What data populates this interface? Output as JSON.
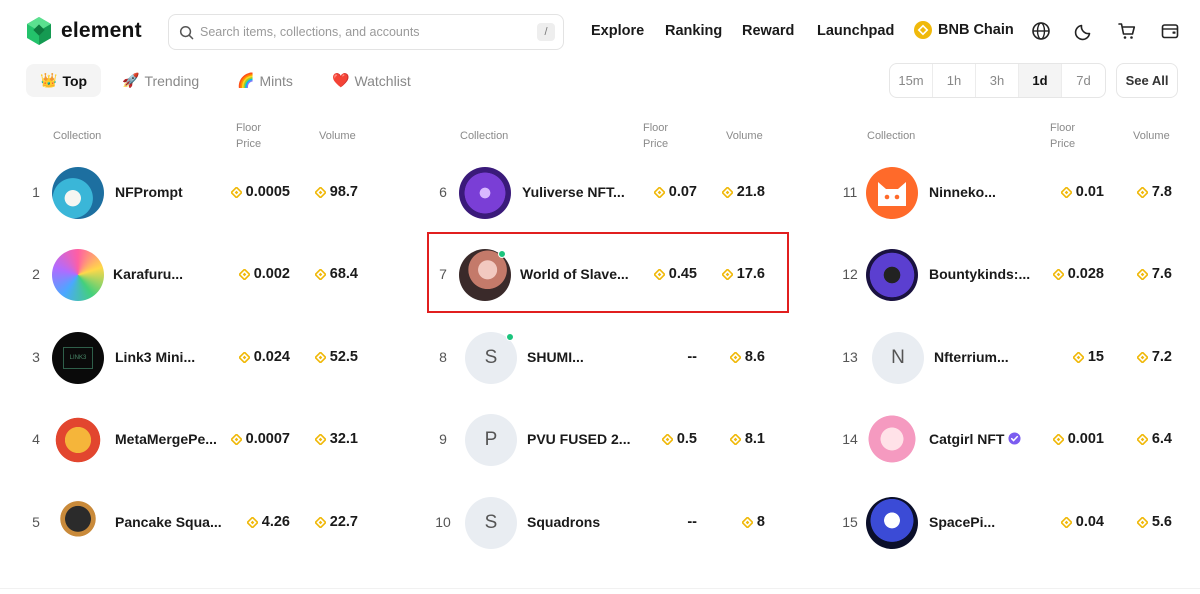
{
  "header": {
    "logo_text": "element",
    "search_placeholder": "Search items, collections, and accounts",
    "search_shortcut": "/",
    "nav": [
      "Explore",
      "Ranking",
      "Reward",
      "Launchpad"
    ],
    "chain_label": "BNB Chain",
    "icons": [
      "globe-icon",
      "moon-icon",
      "cart-icon",
      "wallet-icon"
    ]
  },
  "tabs": [
    {
      "icon": "👑",
      "label": "Top",
      "active": true
    },
    {
      "icon": "🚀",
      "label": "Trending",
      "active": false
    },
    {
      "icon": "🌈",
      "label": "Mints",
      "active": false
    },
    {
      "icon": "❤️",
      "label": "Watchlist",
      "active": false
    }
  ],
  "time_filters": [
    "15m",
    "1h",
    "3h",
    "1d",
    "7d"
  ],
  "time_active": "1d",
  "see_all_label": "See All",
  "columns_header": {
    "collection": "Collection",
    "floor": "Floor Price",
    "volume": "Volume"
  },
  "columns": [
    [
      {
        "rank": "1",
        "name": "NFPrompt",
        "floor": "0.0005",
        "volume": "98.7"
      },
      {
        "rank": "2",
        "name": "Karafuru...",
        "floor": "0.002",
        "volume": "68.4"
      },
      {
        "rank": "3",
        "name": "Link3 Mini...",
        "floor": "0.024",
        "volume": "52.5"
      },
      {
        "rank": "4",
        "name": "MetaMergePe...",
        "floor": "0.0007",
        "volume": "32.1"
      },
      {
        "rank": "5",
        "name": "Pancake Squa...",
        "floor": "4.26",
        "volume": "22.7"
      }
    ],
    [
      {
        "rank": "6",
        "name": "Yuliverse NFT...",
        "floor": "0.07",
        "volume": "21.8"
      },
      {
        "rank": "7",
        "name": "World of Slave...",
        "floor": "0.45",
        "volume": "17.6"
      },
      {
        "rank": "8",
        "name": "SHUMI...",
        "floor": "--",
        "volume": "8.6",
        "letter": "S"
      },
      {
        "rank": "9",
        "name": "PVU FUSED 2...",
        "floor": "0.5",
        "volume": "8.1",
        "letter": "P"
      },
      {
        "rank": "10",
        "name": "Squadrons",
        "floor": "--",
        "volume": "8",
        "letter": "S"
      }
    ],
    [
      {
        "rank": "11",
        "name": "Ninneko...",
        "floor": "0.01",
        "volume": "7.8"
      },
      {
        "rank": "12",
        "name": "Bountykinds:...",
        "floor": "0.028",
        "volume": "7.6"
      },
      {
        "rank": "13",
        "name": "Nfterrium...",
        "floor": "15",
        "volume": "7.2",
        "letter": "N"
      },
      {
        "rank": "14",
        "name": "Catgirl NFT",
        "floor": "0.001",
        "volume": "6.4"
      },
      {
        "rank": "15",
        "name": "SpacePi...",
        "floor": "0.04",
        "volume": "5.6"
      }
    ]
  ],
  "colors": {
    "accent_highlight": "#e11f1f",
    "bnb": "#f0b90b",
    "online_dot": "#1bc47d"
  }
}
